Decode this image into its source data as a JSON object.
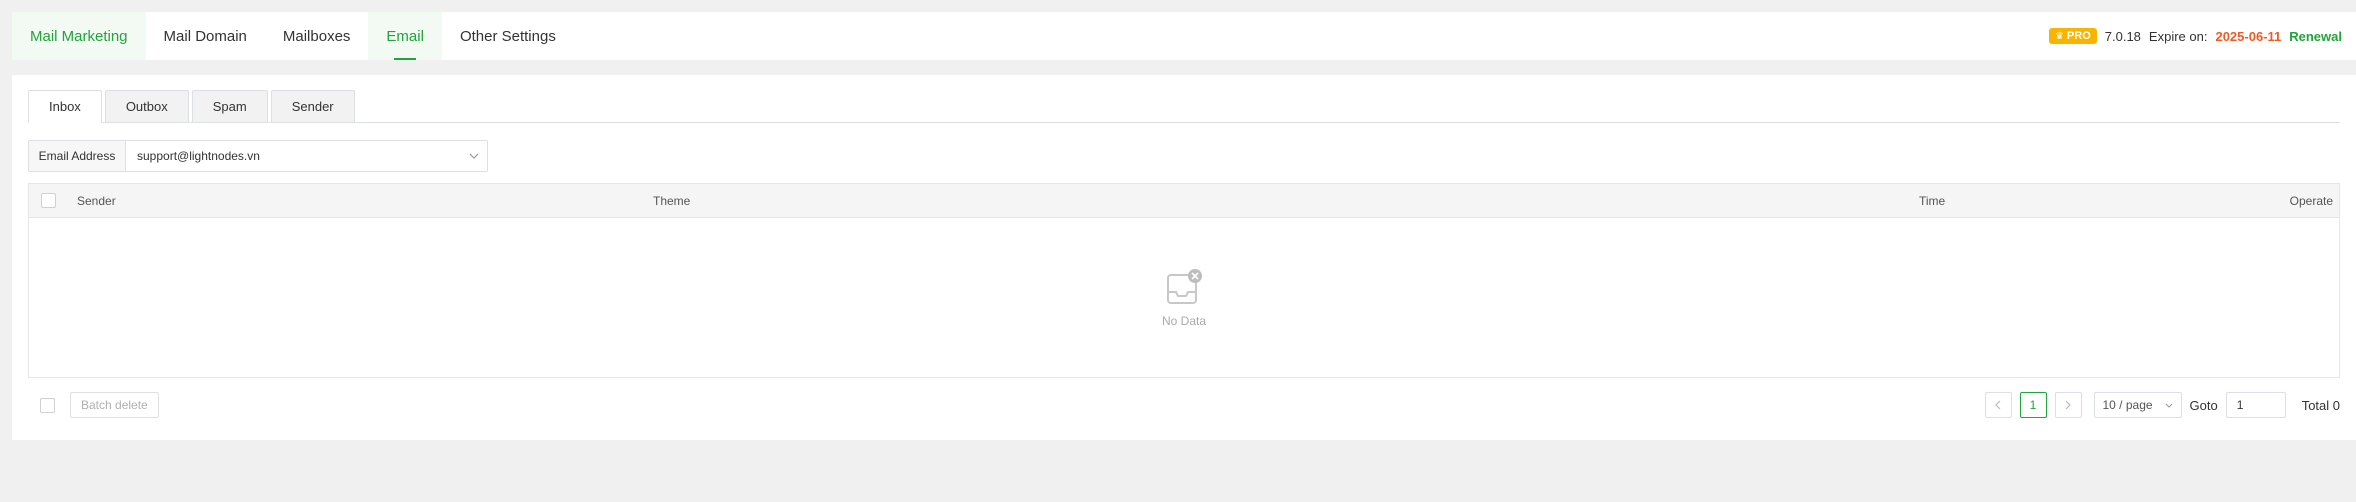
{
  "nav": {
    "tabs": [
      "Mail Marketing",
      "Mail Domain",
      "Mailboxes",
      "Email",
      "Other Settings"
    ],
    "active_index": 3,
    "pro_label": "PRO",
    "version": "7.0.18",
    "expire_label": "Expire on:",
    "expire_date": "2025-06-11",
    "renewal": "Renewal"
  },
  "subtabs": [
    "Inbox",
    "Outbox",
    "Spam",
    "Sender"
  ],
  "active_subtab": 0,
  "filter": {
    "label": "Email Address",
    "value": "support@lightnodes.vn"
  },
  "table": {
    "columns": [
      "Sender",
      "Theme",
      "Time",
      "Operate"
    ],
    "empty_text": "No Data"
  },
  "footer": {
    "batch_delete": "Batch delete"
  },
  "pagination": {
    "current_page": "1",
    "page_size": "10 / page",
    "goto_label": "Goto",
    "goto_value": "1",
    "total": "Total 0"
  },
  "colors": {
    "accent": "#20a53a",
    "pro_badge": "#f7b500",
    "expire": "#f05a24"
  }
}
